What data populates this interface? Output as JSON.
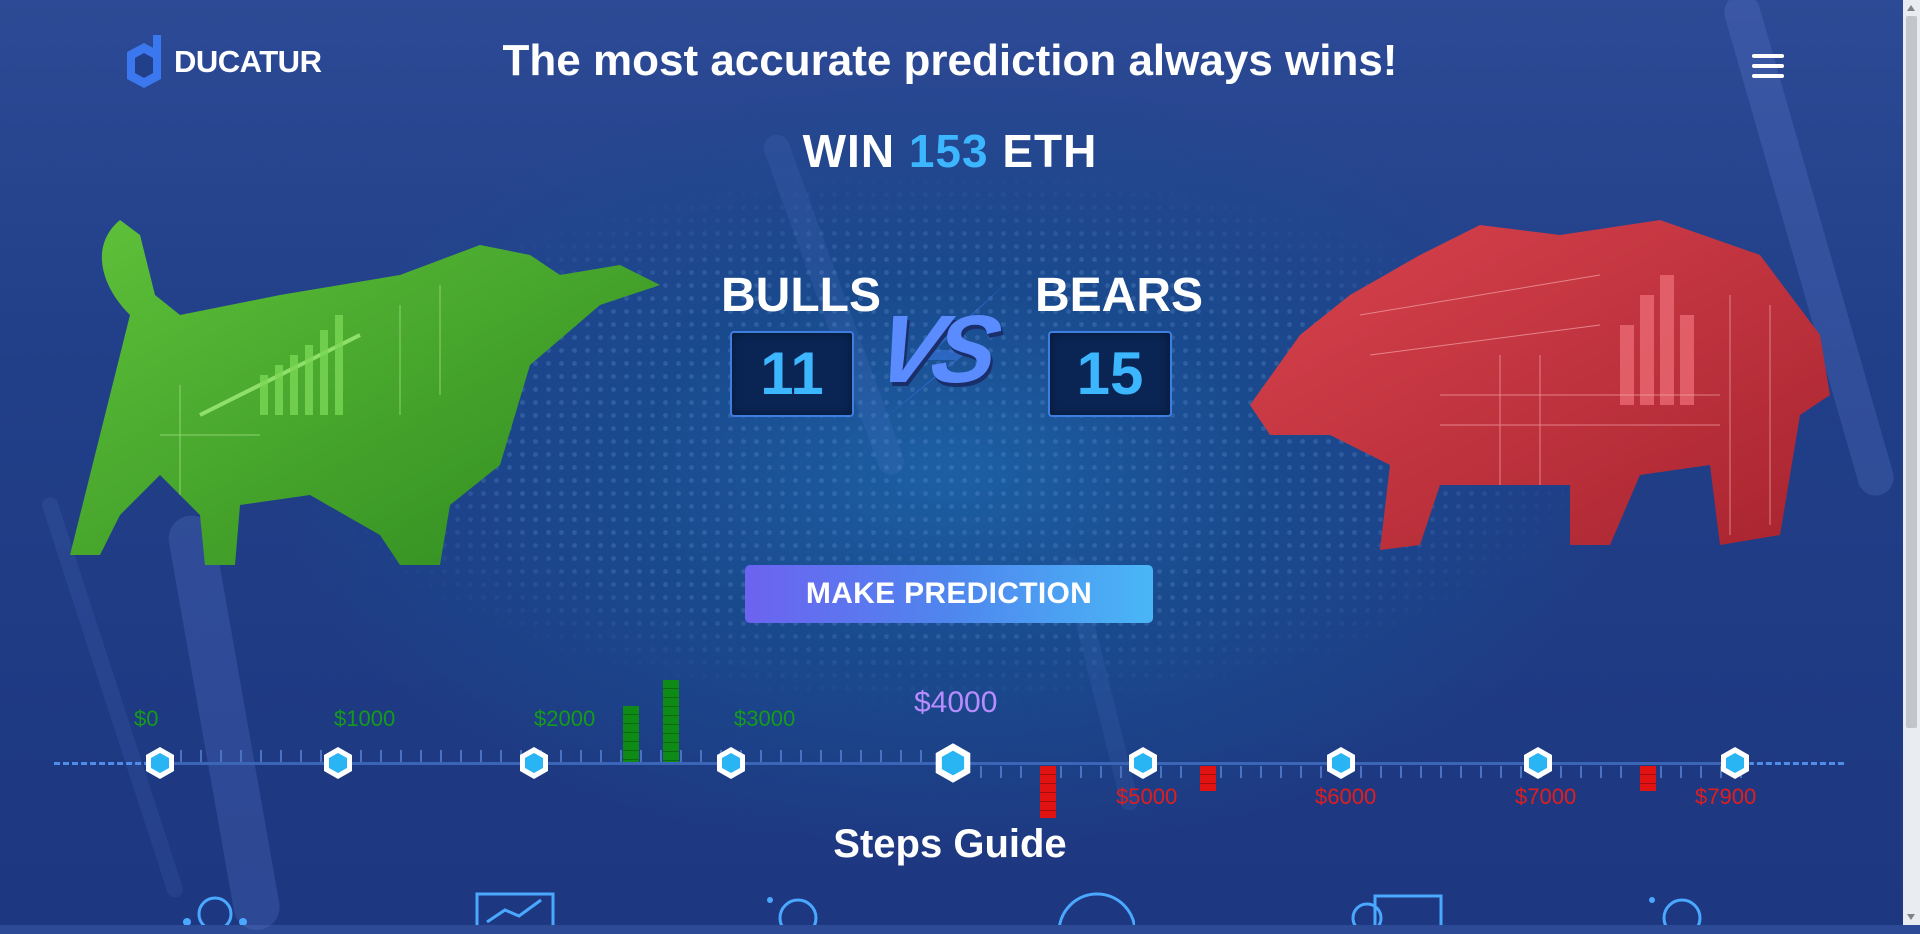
{
  "brand": {
    "name": "DUCATUR"
  },
  "header": {
    "headline": "The most accurate prediction always wins!"
  },
  "prize": {
    "prefix": "WIN",
    "amount": "153",
    "currency": "ETH"
  },
  "teams": {
    "bulls": {
      "label": "BULLS",
      "score": "11",
      "color": "#3aa32b"
    },
    "bears": {
      "label": "BEARS",
      "score": "15",
      "color": "#c4313d"
    },
    "versus": "VS"
  },
  "cta": {
    "label": "MAKE PREDICTION"
  },
  "timeline": {
    "current_price": "$4000",
    "bull_prices": [
      "$0",
      "$1000",
      "$2000",
      "$3000"
    ],
    "bear_prices": [
      "$5000",
      "$6000",
      "$7000",
      "$7900"
    ]
  },
  "steps": {
    "title": "Steps Guide"
  },
  "colors": {
    "accent": "#3bb6ff",
    "bull": "#159a1a",
    "bear": "#e01e1e",
    "current": "#b68cff"
  }
}
